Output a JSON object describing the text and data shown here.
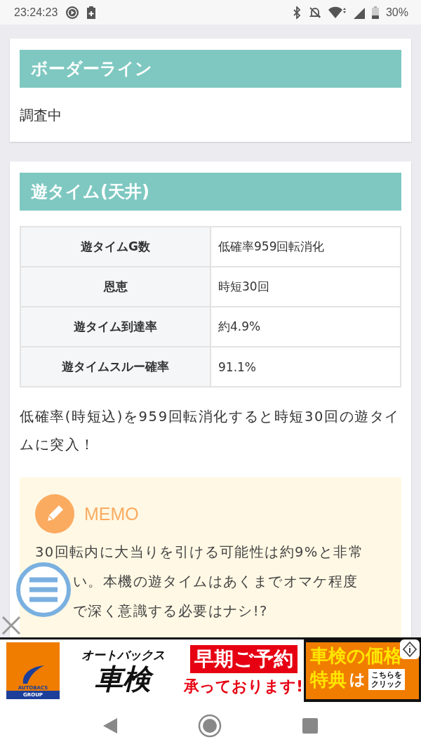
{
  "status_bar": {
    "time": "23:24:23",
    "battery": "30%"
  },
  "sections": [
    {
      "heading": "ボーダーライン",
      "body": "調査中"
    },
    {
      "heading": "遊タイム(天井)",
      "table": [
        {
          "label": "遊タイムG数",
          "value": "低確率959回転消化"
        },
        {
          "label": "恩恵",
          "value": "時短30回"
        },
        {
          "label": "遊タイム到達率",
          "value": "約4.9%"
        },
        {
          "label": "遊タイムスルー確率",
          "value": "91.1%"
        }
      ],
      "paragraph": "低確率(時短込)を959回転消化すると時短30回の遊タイムに突入！",
      "memo": {
        "title": "MEMO",
        "lines": [
          "30回転内に大当りを引ける可能性は約9%と非常",
          "い。本機の遊タイムはあくまでオマケ程度",
          "で深く意識する必要はナシ!?"
        ]
      }
    }
  ],
  "ad": {
    "logo_top": "AUTOBACS",
    "logo_bottom": "GROUP",
    "brand": "オートバックス",
    "product": "車検",
    "headline": "早期ご予約",
    "subline": "承っております!",
    "offer_line1": "車検の価格",
    "offer_line2": "特典",
    "offer_particle": "は",
    "cta_line1": "こちらを",
    "cta_line2": "クリック"
  }
}
